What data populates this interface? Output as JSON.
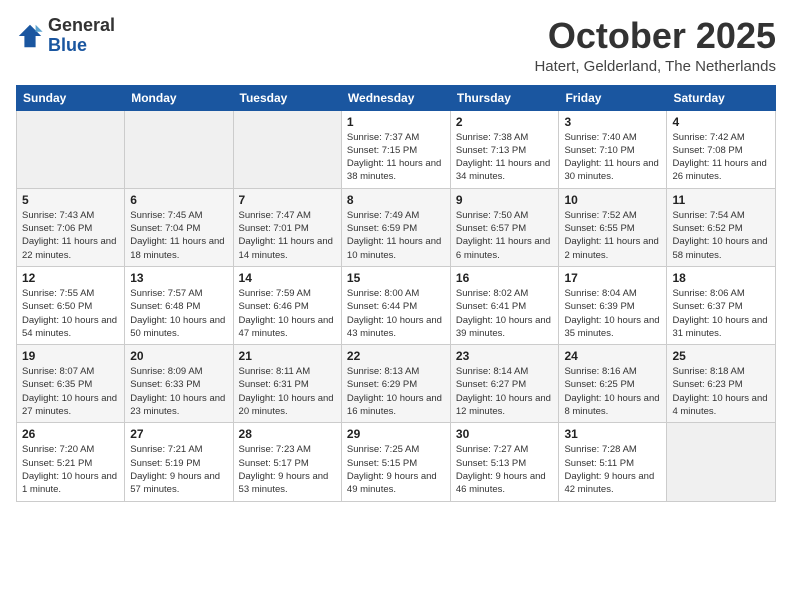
{
  "header": {
    "logo_general": "General",
    "logo_blue": "Blue",
    "month_title": "October 2025",
    "location": "Hatert, Gelderland, The Netherlands"
  },
  "weekdays": [
    "Sunday",
    "Monday",
    "Tuesday",
    "Wednesday",
    "Thursday",
    "Friday",
    "Saturday"
  ],
  "weeks": [
    [
      {
        "day": "",
        "sunrise": "",
        "sunset": "",
        "daylight": ""
      },
      {
        "day": "",
        "sunrise": "",
        "sunset": "",
        "daylight": ""
      },
      {
        "day": "",
        "sunrise": "",
        "sunset": "",
        "daylight": ""
      },
      {
        "day": "1",
        "sunrise": "Sunrise: 7:37 AM",
        "sunset": "Sunset: 7:15 PM",
        "daylight": "Daylight: 11 hours and 38 minutes."
      },
      {
        "day": "2",
        "sunrise": "Sunrise: 7:38 AM",
        "sunset": "Sunset: 7:13 PM",
        "daylight": "Daylight: 11 hours and 34 minutes."
      },
      {
        "day": "3",
        "sunrise": "Sunrise: 7:40 AM",
        "sunset": "Sunset: 7:10 PM",
        "daylight": "Daylight: 11 hours and 30 minutes."
      },
      {
        "day": "4",
        "sunrise": "Sunrise: 7:42 AM",
        "sunset": "Sunset: 7:08 PM",
        "daylight": "Daylight: 11 hours and 26 minutes."
      }
    ],
    [
      {
        "day": "5",
        "sunrise": "Sunrise: 7:43 AM",
        "sunset": "Sunset: 7:06 PM",
        "daylight": "Daylight: 11 hours and 22 minutes."
      },
      {
        "day": "6",
        "sunrise": "Sunrise: 7:45 AM",
        "sunset": "Sunset: 7:04 PM",
        "daylight": "Daylight: 11 hours and 18 minutes."
      },
      {
        "day": "7",
        "sunrise": "Sunrise: 7:47 AM",
        "sunset": "Sunset: 7:01 PM",
        "daylight": "Daylight: 11 hours and 14 minutes."
      },
      {
        "day": "8",
        "sunrise": "Sunrise: 7:49 AM",
        "sunset": "Sunset: 6:59 PM",
        "daylight": "Daylight: 11 hours and 10 minutes."
      },
      {
        "day": "9",
        "sunrise": "Sunrise: 7:50 AM",
        "sunset": "Sunset: 6:57 PM",
        "daylight": "Daylight: 11 hours and 6 minutes."
      },
      {
        "day": "10",
        "sunrise": "Sunrise: 7:52 AM",
        "sunset": "Sunset: 6:55 PM",
        "daylight": "Daylight: 11 hours and 2 minutes."
      },
      {
        "day": "11",
        "sunrise": "Sunrise: 7:54 AM",
        "sunset": "Sunset: 6:52 PM",
        "daylight": "Daylight: 10 hours and 58 minutes."
      }
    ],
    [
      {
        "day": "12",
        "sunrise": "Sunrise: 7:55 AM",
        "sunset": "Sunset: 6:50 PM",
        "daylight": "Daylight: 10 hours and 54 minutes."
      },
      {
        "day": "13",
        "sunrise": "Sunrise: 7:57 AM",
        "sunset": "Sunset: 6:48 PM",
        "daylight": "Daylight: 10 hours and 50 minutes."
      },
      {
        "day": "14",
        "sunrise": "Sunrise: 7:59 AM",
        "sunset": "Sunset: 6:46 PM",
        "daylight": "Daylight: 10 hours and 47 minutes."
      },
      {
        "day": "15",
        "sunrise": "Sunrise: 8:00 AM",
        "sunset": "Sunset: 6:44 PM",
        "daylight": "Daylight: 10 hours and 43 minutes."
      },
      {
        "day": "16",
        "sunrise": "Sunrise: 8:02 AM",
        "sunset": "Sunset: 6:41 PM",
        "daylight": "Daylight: 10 hours and 39 minutes."
      },
      {
        "day": "17",
        "sunrise": "Sunrise: 8:04 AM",
        "sunset": "Sunset: 6:39 PM",
        "daylight": "Daylight: 10 hours and 35 minutes."
      },
      {
        "day": "18",
        "sunrise": "Sunrise: 8:06 AM",
        "sunset": "Sunset: 6:37 PM",
        "daylight": "Daylight: 10 hours and 31 minutes."
      }
    ],
    [
      {
        "day": "19",
        "sunrise": "Sunrise: 8:07 AM",
        "sunset": "Sunset: 6:35 PM",
        "daylight": "Daylight: 10 hours and 27 minutes."
      },
      {
        "day": "20",
        "sunrise": "Sunrise: 8:09 AM",
        "sunset": "Sunset: 6:33 PM",
        "daylight": "Daylight: 10 hours and 23 minutes."
      },
      {
        "day": "21",
        "sunrise": "Sunrise: 8:11 AM",
        "sunset": "Sunset: 6:31 PM",
        "daylight": "Daylight: 10 hours and 20 minutes."
      },
      {
        "day": "22",
        "sunrise": "Sunrise: 8:13 AM",
        "sunset": "Sunset: 6:29 PM",
        "daylight": "Daylight: 10 hours and 16 minutes."
      },
      {
        "day": "23",
        "sunrise": "Sunrise: 8:14 AM",
        "sunset": "Sunset: 6:27 PM",
        "daylight": "Daylight: 10 hours and 12 minutes."
      },
      {
        "day": "24",
        "sunrise": "Sunrise: 8:16 AM",
        "sunset": "Sunset: 6:25 PM",
        "daylight": "Daylight: 10 hours and 8 minutes."
      },
      {
        "day": "25",
        "sunrise": "Sunrise: 8:18 AM",
        "sunset": "Sunset: 6:23 PM",
        "daylight": "Daylight: 10 hours and 4 minutes."
      }
    ],
    [
      {
        "day": "26",
        "sunrise": "Sunrise: 7:20 AM",
        "sunset": "Sunset: 5:21 PM",
        "daylight": "Daylight: 10 hours and 1 minute."
      },
      {
        "day": "27",
        "sunrise": "Sunrise: 7:21 AM",
        "sunset": "Sunset: 5:19 PM",
        "daylight": "Daylight: 9 hours and 57 minutes."
      },
      {
        "day": "28",
        "sunrise": "Sunrise: 7:23 AM",
        "sunset": "Sunset: 5:17 PM",
        "daylight": "Daylight: 9 hours and 53 minutes."
      },
      {
        "day": "29",
        "sunrise": "Sunrise: 7:25 AM",
        "sunset": "Sunset: 5:15 PM",
        "daylight": "Daylight: 9 hours and 49 minutes."
      },
      {
        "day": "30",
        "sunrise": "Sunrise: 7:27 AM",
        "sunset": "Sunset: 5:13 PM",
        "daylight": "Daylight: 9 hours and 46 minutes."
      },
      {
        "day": "31",
        "sunrise": "Sunrise: 7:28 AM",
        "sunset": "Sunset: 5:11 PM",
        "daylight": "Daylight: 9 hours and 42 minutes."
      },
      {
        "day": "",
        "sunrise": "",
        "sunset": "",
        "daylight": ""
      }
    ]
  ]
}
